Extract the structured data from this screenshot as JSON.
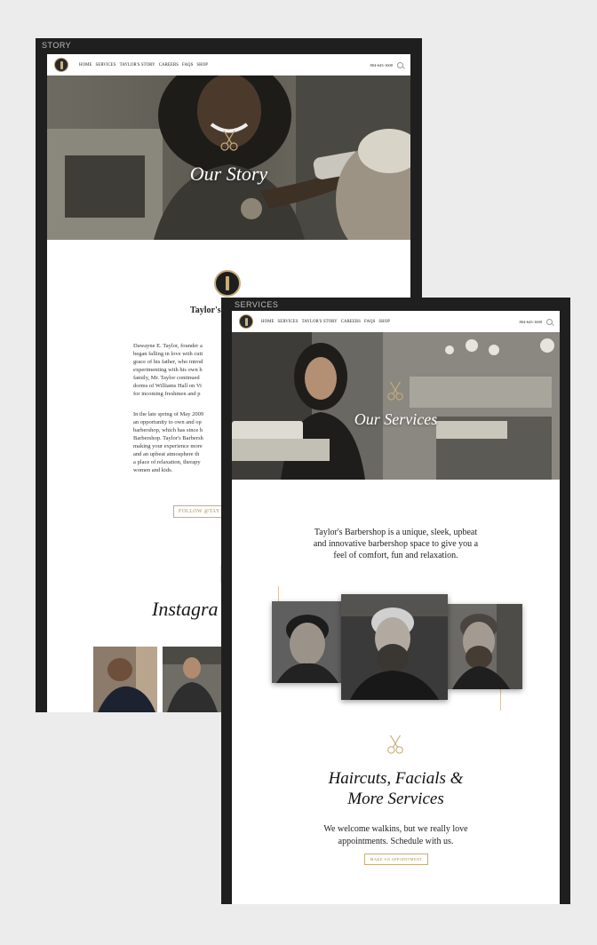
{
  "story": {
    "frame_label": "STORY",
    "nav": {
      "items": [
        "HOME",
        "SERVICES",
        "TAYLOR'S STORY",
        "CAREERS",
        "FAQS",
        "SHOP"
      ],
      "phone": "804-643-1600"
    },
    "hero_title": "Our Story",
    "heading_partial": "Taylor's",
    "subheading_partial": "sin",
    "paragraph1": [
      "Dawayne E. Taylor, founder a",
      "began falling in love with cutt",
      "grace of his father, who introd",
      "experimenting with his own h",
      "family, Mr. Taylor continued",
      "dorms of Williams Hall on Vi",
      "for incoming freshmen and p"
    ],
    "paragraph2": [
      "In the late spring of May 2009",
      "an opportunity to own and op",
      "barbershop, which has since b",
      "Barbershop. Taylor's Barbersh",
      "making your experience more",
      "and an upbeat atmosphere th",
      "a place of relaxation, therapy",
      "women and kids."
    ],
    "follow_button": "FOLLOW @TAY",
    "instagram_heading": "Instagra"
  },
  "services": {
    "frame_label": "SERVICES",
    "nav": {
      "items": [
        "HOME",
        "SERVICES",
        "TAYLOR'S STORY",
        "CAREERS",
        "FAQS",
        "SHOP"
      ],
      "phone": "804-643-1600"
    },
    "hero_title": "Our Services",
    "intro": [
      "Taylor's Barbershop is a unique, sleek, upbeat",
      "and innovative barbershop space to give you a",
      "feel of comfort, fun and relaxation."
    ],
    "heading": [
      "Haircuts, Facials &",
      "More Services"
    ],
    "subtext": [
      "We welcome walkins, but we really love",
      "appointments.  Schedule with us."
    ],
    "cta_button": "MAKE AN APPOINTMENT"
  },
  "colors": {
    "gold": "#c9ab79",
    "frame": "#1f1f1f",
    "bg": "#ececec"
  },
  "icons": [
    "search-icon",
    "scissors-icon",
    "logo-icon"
  ]
}
